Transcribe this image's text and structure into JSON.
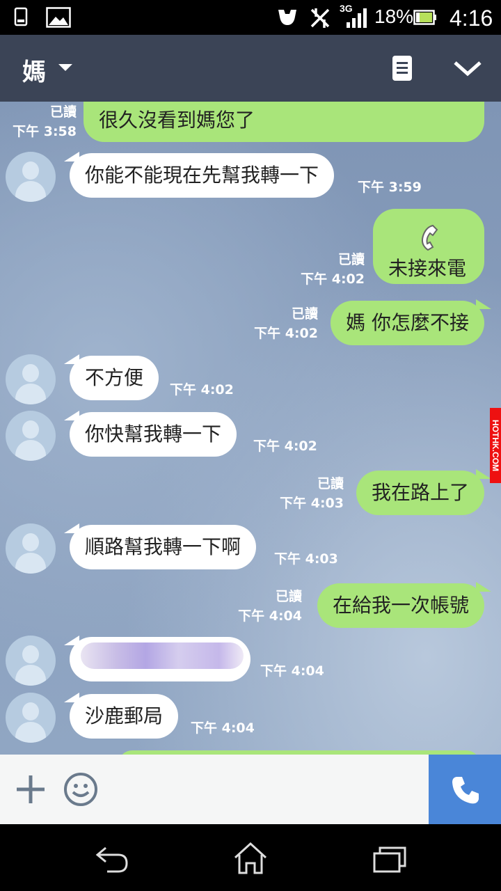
{
  "status_bar": {
    "network": "3G",
    "battery": "18%",
    "time": "4:16"
  },
  "header": {
    "title": "媽"
  },
  "messages": [
    {
      "dir": "out",
      "text": "很久沒看到媽您了",
      "read": "已讀",
      "time": "下午 3:58"
    },
    {
      "dir": "in",
      "text": "你能不能現在先幫我轉一下",
      "time": "下午 3:59"
    },
    {
      "dir": "out",
      "text": "未接來電",
      "read": "已讀",
      "time": "下午 4:02"
    },
    {
      "dir": "out",
      "text": "媽 你怎麼不接",
      "read": "已讀",
      "time": "下午 4:02"
    },
    {
      "dir": "in",
      "text": "不方便",
      "time": "下午 4:02"
    },
    {
      "dir": "in",
      "text": "你快幫我轉一下",
      "time": "下午 4:02"
    },
    {
      "dir": "out",
      "text": "我在路上了",
      "read": "已讀",
      "time": "下午 4:03"
    },
    {
      "dir": "in",
      "text": "順路幫我轉一下啊",
      "time": "下午 4:03"
    },
    {
      "dir": "out",
      "text": "在給我一次帳號",
      "read": "已讀",
      "time": "下午 4:04"
    },
    {
      "dir": "in",
      "text": "",
      "time": "下午 4:04"
    },
    {
      "dir": "in",
      "text": "沙鹿郵局",
      "time": "下午 4:04"
    }
  ],
  "watermark": "HOTHK.COM",
  "colors": {
    "header": "#3b4456",
    "bubble_out": "#a9e57a",
    "bubble_in": "#ffffff",
    "call_button": "#4a86d8"
  }
}
